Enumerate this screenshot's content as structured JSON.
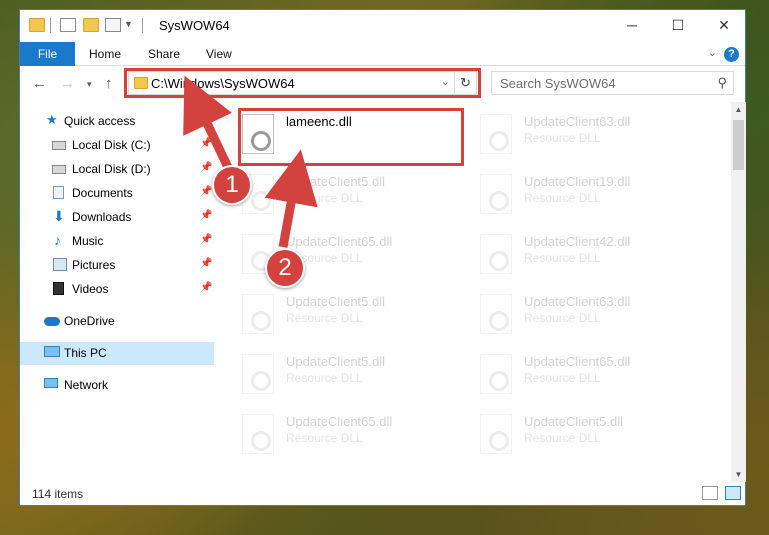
{
  "window": {
    "title": "SysWOW64"
  },
  "ribbon": {
    "tabs": [
      "File",
      "Home",
      "Share",
      "View"
    ],
    "help": "?"
  },
  "address": {
    "path": "C:\\Windows\\SysWOW64",
    "search_placeholder": "Search SysWOW64"
  },
  "sidebar": {
    "items": [
      {
        "label": "Quick access"
      },
      {
        "label": "Local Disk (C:)"
      },
      {
        "label": "Local Disk (D:)"
      },
      {
        "label": "Documents"
      },
      {
        "label": "Downloads"
      },
      {
        "label": "Music"
      },
      {
        "label": "Pictures"
      },
      {
        "label": "Videos"
      },
      {
        "label": "OneDrive"
      },
      {
        "label": "This PC"
      },
      {
        "label": "Network"
      }
    ]
  },
  "files": [
    {
      "name": "lameenc.dll",
      "type": ""
    },
    {
      "name": "UpdateClient63.dll",
      "type": "Resource DLL"
    },
    {
      "name": "UpdateClient5.dll",
      "type": "Resource DLL"
    },
    {
      "name": "UpdateClient19.dll",
      "type": "Resource DLL"
    },
    {
      "name": "UpdateClient65.dll",
      "type": "Resource DLL"
    },
    {
      "name": "UpdateClient42.dll",
      "type": "Resource DLL"
    },
    {
      "name": "UpdateClient5.dll",
      "type": "Resource DLL"
    },
    {
      "name": "UpdateClient63.dll",
      "type": "Resource DLL"
    },
    {
      "name": "UpdateClient5.dll",
      "type": "Resource DLL"
    },
    {
      "name": "UpdateClient65.dll",
      "type": "Resource DLL"
    },
    {
      "name": "UpdateClient65.dll",
      "type": "Resource DLL"
    },
    {
      "name": "UpdateClient5.dll",
      "type": "Resource DLL"
    }
  ],
  "status": {
    "items_count": "114 items"
  },
  "annotations": {
    "step1": "1",
    "step2": "2"
  },
  "colors": {
    "accent": "#1979ca",
    "highlight": "#d2423f",
    "selected": "#cce8ff"
  }
}
